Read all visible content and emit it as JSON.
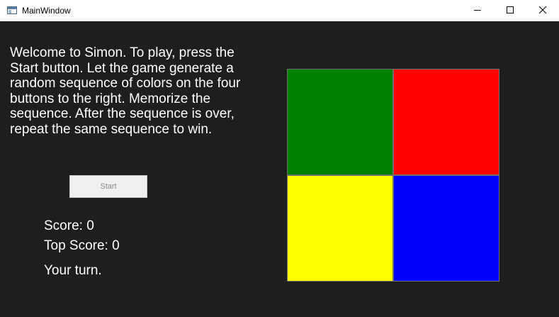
{
  "window": {
    "title": "MainWindow",
    "controls": [
      "minimize-icon",
      "maximize-icon",
      "close-icon"
    ]
  },
  "instructions": "Welcome to Simon. To play, press the Start button. Let the game generate a random sequence of colors on the four buttons to the right. Memorize the sequence. After the sequence is over, repeat the same sequence to win.",
  "start_button": {
    "label": "Start",
    "enabled": false
  },
  "status": {
    "score": "Score: 0",
    "top_score": "Top Score: 0",
    "turn": "Your turn."
  },
  "board": {
    "pads": [
      {
        "name": "green",
        "color": "#008000"
      },
      {
        "name": "red",
        "color": "#ff0000"
      },
      {
        "name": "yellow",
        "color": "#ffff00"
      },
      {
        "name": "blue",
        "color": "#0000ff"
      }
    ]
  },
  "colors": {
    "background": "#1e1e1e",
    "titlebar": "#ffffff",
    "text": "#ffffff"
  }
}
